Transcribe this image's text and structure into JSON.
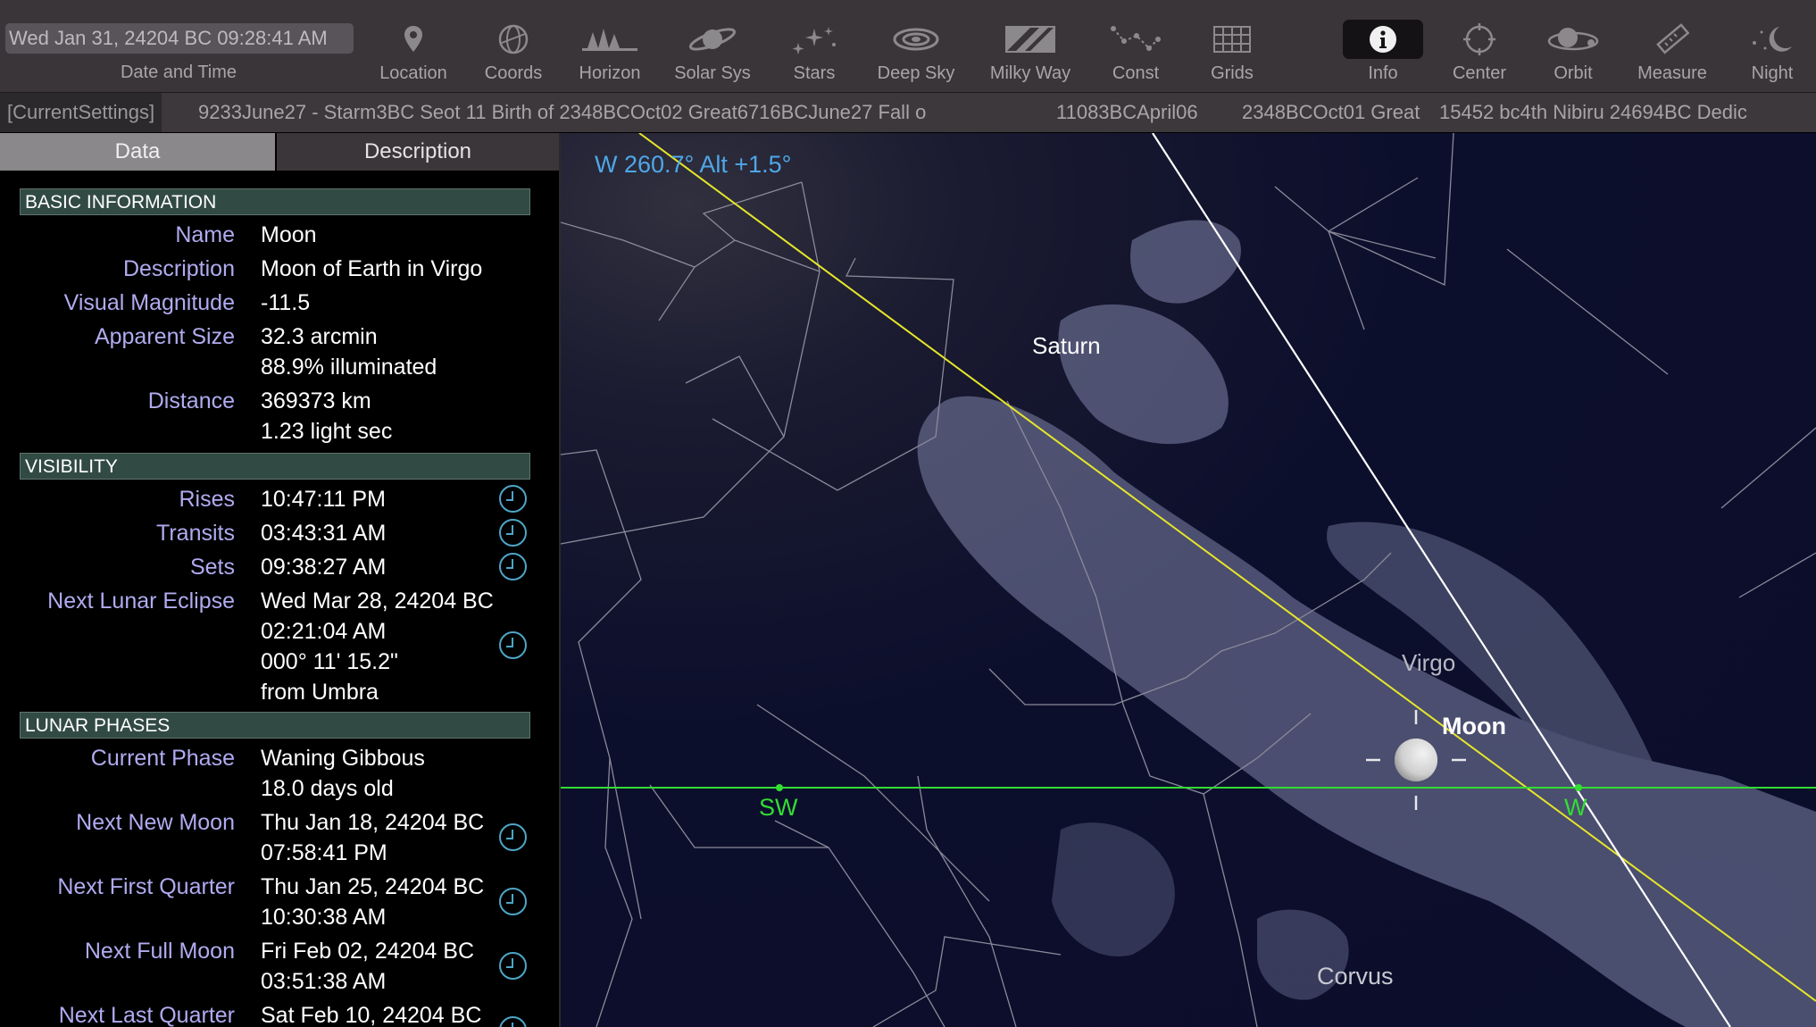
{
  "toolbar": {
    "datetime": "Wed Jan 31, 24204 BC 09:28:41 AM",
    "datetime_label": "Date and Time",
    "tools": [
      {
        "label": "Location",
        "icon": "location-pin-icon"
      },
      {
        "label": "Coords",
        "icon": "coords-globe-icon"
      },
      {
        "label": "Horizon",
        "icon": "horizon-trees-icon"
      },
      {
        "label": "Solar Sys",
        "icon": "saturn-icon"
      },
      {
        "label": "Stars",
        "icon": "stars-icon"
      },
      {
        "label": "Deep Sky",
        "icon": "galaxy-icon"
      },
      {
        "label": "Milky Way",
        "icon": "milky-way-icon"
      },
      {
        "label": "Const",
        "icon": "constellation-icon"
      },
      {
        "label": "Grids",
        "icon": "grid-icon"
      },
      {
        "label": "Info",
        "icon": "info-icon",
        "active": true
      },
      {
        "label": "Center",
        "icon": "center-target-icon"
      },
      {
        "label": "Orbit",
        "icon": "orbit-icon"
      },
      {
        "label": "Measure",
        "icon": "ruler-icon"
      },
      {
        "label": "Night",
        "icon": "moon-stars-icon"
      }
    ]
  },
  "settings_strip": {
    "current": "[CurrentSettings]",
    "items": [
      "9233June27 - Starm3BC Seot 11 Birth of 2348BCOct02 Great6716BCJune27 Fall o",
      "11083BCApril06",
      "2348BCOct01 Great",
      "15452 bc4th Nibiru 24694BC Dedic"
    ]
  },
  "panel": {
    "tabs": {
      "data": "Data",
      "description": "Description"
    },
    "sections": {
      "basic": "BASIC INFORMATION",
      "visibility": "VISIBILITY",
      "lunar": "LUNAR PHASES"
    },
    "basic": {
      "name_label": "Name",
      "name": "Moon",
      "description_label": "Description",
      "description": "Moon of Earth in Virgo",
      "magnitude_label": "Visual Magnitude",
      "magnitude": "-11.5",
      "size_label": "Apparent Size",
      "size": "32.3 arcmin",
      "illuminated": "88.9% illuminated",
      "distance_label": "Distance",
      "distance_km": "369373 km",
      "distance_ls": "1.23 light sec"
    },
    "visibility": {
      "rises_label": "Rises",
      "rises": "10:47:11 PM",
      "transits_label": "Transits",
      "transits": "03:43:31 AM",
      "sets_label": "Sets",
      "sets": "09:38:27 AM",
      "eclipse_label": "Next Lunar Eclipse",
      "eclipse_date": "Wed Mar 28, 24204 BC",
      "eclipse_time": "02:21:04 AM",
      "eclipse_angle": "000° 11' 15.2\"",
      "eclipse_from": "from Umbra"
    },
    "lunar": {
      "phase_label": "Current Phase",
      "phase": "Waning Gibbous",
      "age": "18.0 days old",
      "new_label": "Next New Moon",
      "new_date": "Thu Jan 18, 24204 BC",
      "new_time": "07:58:41 PM",
      "first_label": "Next First Quarter",
      "first_date": "Thu Jan 25, 24204 BC",
      "first_time": "10:30:38 AM",
      "full_label": "Next Full Moon",
      "full_date": "Fri Feb 02, 24204 BC",
      "full_time": "03:51:38 AM",
      "last_label": "Next Last Quarter",
      "last_date": "Sat Feb 10, 24204 BC"
    }
  },
  "sky": {
    "az_alt": "W 260.7° Alt +1.5°",
    "labels": {
      "saturn": "Saturn",
      "virgo": "Virgo",
      "moon": "Moon",
      "corvus": "Corvus",
      "sw": "SW",
      "w": "W"
    },
    "colors": {
      "ecliptic": "#e6e62a",
      "horizon": "#33dd33",
      "azimuth_line": "#ffffff",
      "const_lines": "#8a8a9a",
      "coordinate_text": "#4fa7e8"
    }
  }
}
